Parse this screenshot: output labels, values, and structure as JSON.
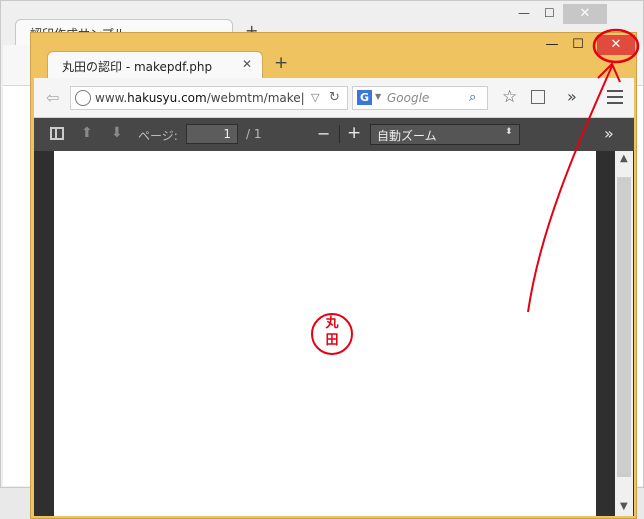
{
  "back_window": {
    "tab_title": "認印作成サンプル",
    "new_tab": "+",
    "minimize": "—",
    "maximize": "☐",
    "close": "✕"
  },
  "window": {
    "minimize": "—",
    "maximize": "☐",
    "close": "✕"
  },
  "tab": {
    "title": "丸田の認印 - makepdf.php",
    "close": "✕",
    "new_tab": "+"
  },
  "toolbar": {
    "url_prefix": "www.",
    "url_domain": "hakusyu.com",
    "url_path": "/webmtm/make|",
    "search_engine_icon": "G",
    "search_placeholder": "Google",
    "search_icon": "⌕",
    "bookmark_icon": "☆",
    "overflow": "»"
  },
  "pdf_viewer": {
    "page_label": "ページ:",
    "page_current": "1",
    "page_total": "/ 1",
    "zoom_out": "−",
    "zoom_in": "+",
    "zoom_value": "自動ズーム",
    "zoom_arrow": "⬍",
    "more": "»"
  },
  "document": {
    "seal_top": "丸",
    "seal_bottom": "田",
    "seal_color": "#e60012"
  },
  "colors": {
    "window_frame": "#efc360",
    "close_button": "#e04b3d",
    "annotation": "#e60012"
  }
}
